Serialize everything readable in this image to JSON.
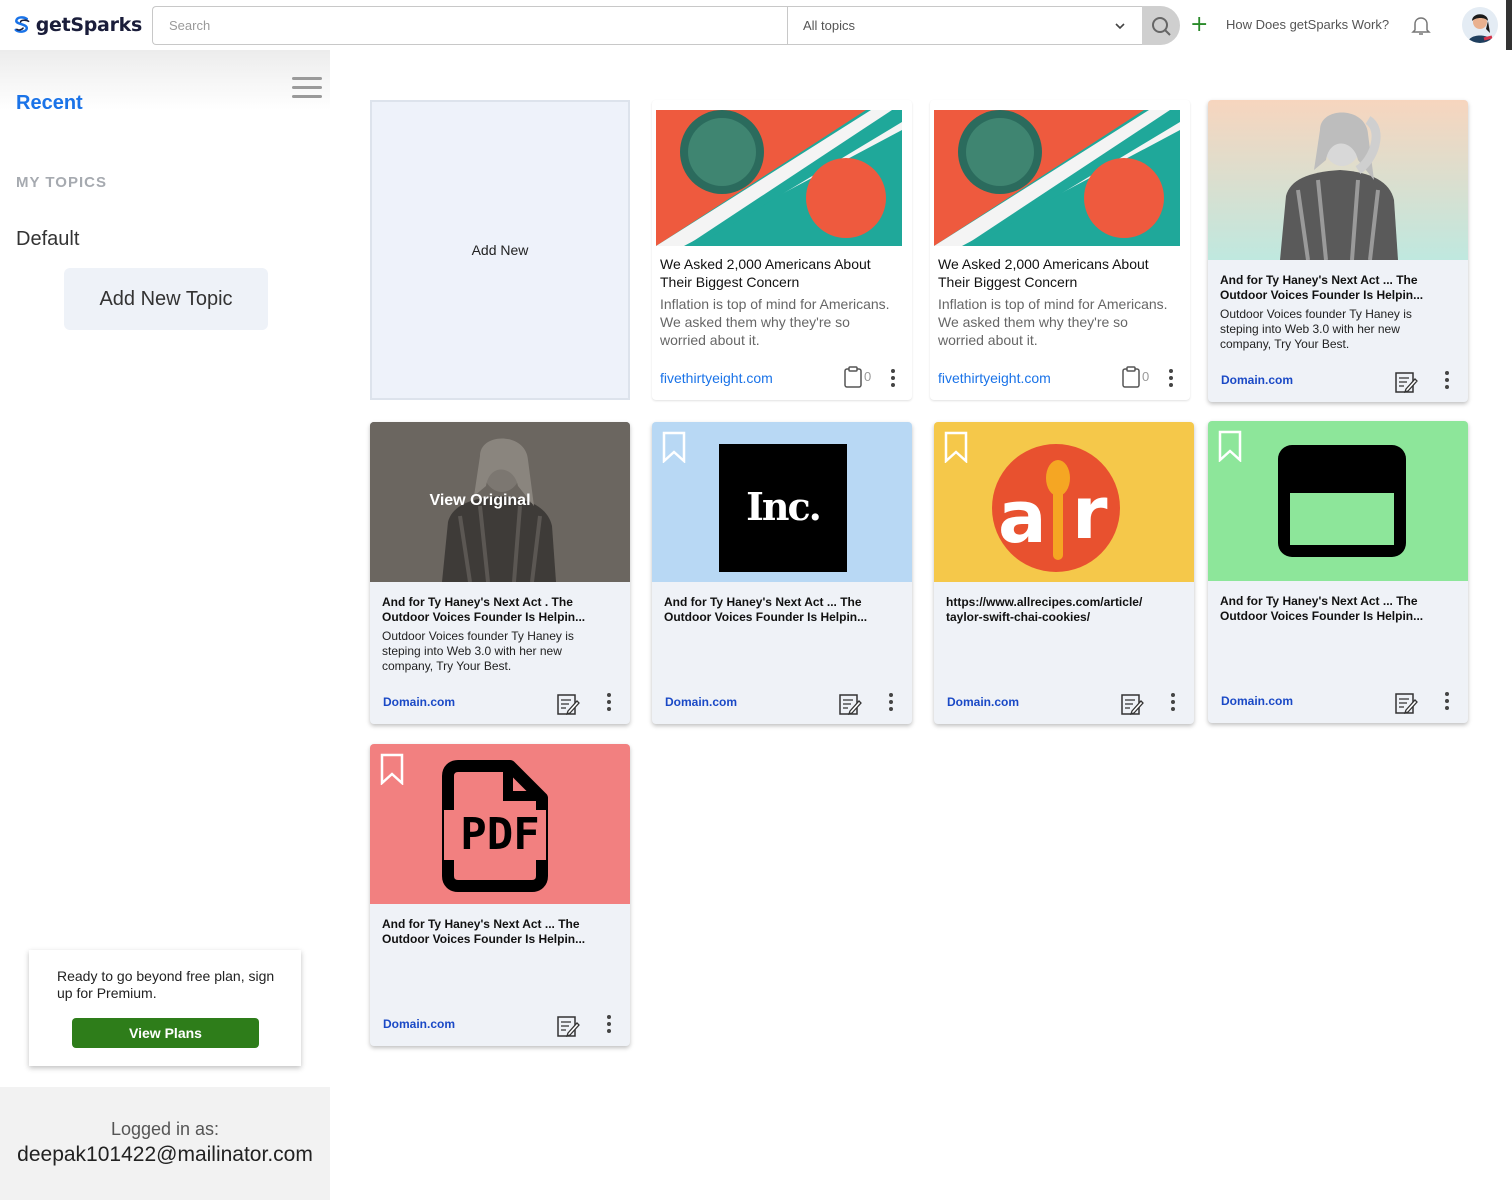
{
  "app": {
    "name": "getSparks"
  },
  "header": {
    "search_placeholder": "Search",
    "topic_select": "All topics",
    "how_link": "How Does getSparks Work?"
  },
  "sidebar": {
    "recent": "Recent",
    "my_topics": "MY TOPICS",
    "topics": [
      "Default"
    ],
    "add_topic": "Add New Topic",
    "premium_msg": "Ready to go beyond free plan, sign up for Premium.",
    "premium_btn": "View Plans",
    "logged_label": "Logged in as:",
    "logged_email": "deepak101422@mailinator.com"
  },
  "grid": {
    "add_new": "Add New",
    "articles": [
      {
        "title": "We Asked 2,000 Americans About Their Biggest Concern",
        "desc": "Inflation is top of mind for Americans. We asked them why they're so worried about it.",
        "domain": "fivethirtyeight.com",
        "clip_count": "0"
      },
      {
        "title": "We Asked 2,000 Americans About Their Biggest Concern",
        "desc": "Inflation is top of mind for Americans. We asked them why they're so worried about it.",
        "domain": "fivethirtyeight.com",
        "clip_count": "0"
      }
    ],
    "cards": [
      {
        "title": "And for Ty Haney's Next Act ... The Outdoor Voices Founder Is Helpin...",
        "desc": "Outdoor Voices founder Ty Haney is steping into Web 3.0 with her new company, Try Your Best.",
        "domain": "Domain.com"
      },
      {
        "title": "And for Ty Haney's Next Act  . The Outdoor Voices Founder Is Helpin...",
        "desc": "Outdoor Voices founder Ty Haney is steping into Web 3.0 with her new company, Try Your Best.",
        "domain": "Domain.com",
        "overlay": "View Original"
      },
      {
        "title": "And for Ty Haney's Next Act ... The Outdoor Voices Founder Is Helpin...",
        "domain": "Domain.com",
        "logo": "Inc."
      },
      {
        "title": "https://www.allrecipes.com/article/ taylor-swift-chai-cookies/",
        "domain": "Domain.com"
      },
      {
        "title": "And for Ty Haney's Next Act ... The Outdoor Voices Founder Is Helpin...",
        "domain": "Domain.com"
      },
      {
        "title": "And for Ty Haney's Next Act ... The Outdoor Voices Founder Is Helpin...",
        "domain": "Domain.com",
        "logo": "PDF"
      }
    ]
  },
  "colors": {
    "accent": "#1a73e8",
    "brand_green": "#2e7d1a",
    "card_blue": "#b8d8f4",
    "card_yellow": "#f5c84a",
    "card_green": "#8de69a",
    "card_red": "#f28080"
  }
}
